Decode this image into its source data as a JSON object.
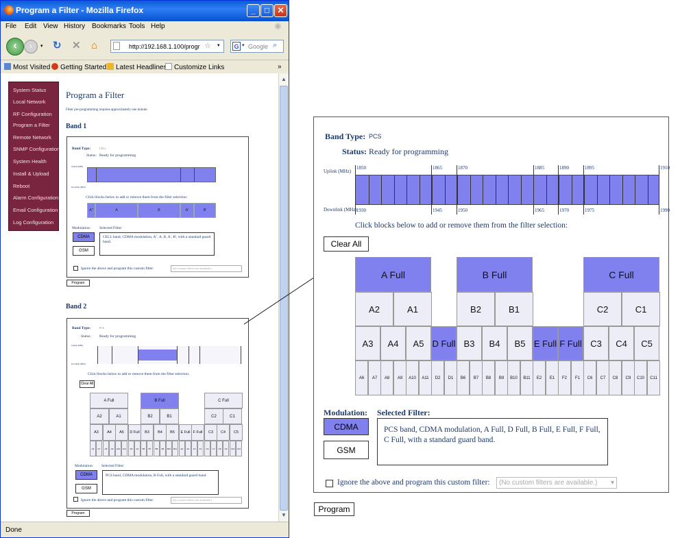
{
  "browser": {
    "title": "Program a Filter - Mozilla Firefox",
    "menu": [
      "File",
      "Edit",
      "View",
      "History",
      "Bookmarks",
      "Tools",
      "Help"
    ],
    "url": "http://192.168.1.100/progr",
    "search_placeholder": "Google",
    "bookmarks": [
      "Most Visited",
      "Getting Started",
      "Latest Headlines",
      "Customize Links"
    ],
    "status": "Done"
  },
  "sidebar": {
    "items": [
      "System Status",
      "Local Network",
      "RF Configuration",
      "Program a Filter",
      "Remote Network",
      "SNMP Configuration",
      "System Health",
      "Install & Upload",
      "Reboot",
      "Alarm Configuration",
      "Email Configuration",
      "Log Configuration"
    ]
  },
  "page": {
    "title": "Program a Filter",
    "note": "Filter pre-programming requires approximately one minute.",
    "band1_heading": "Band 1",
    "band2_heading": "Band 2",
    "program_label": "Program"
  },
  "band1": {
    "band_type_label": "Band Type:",
    "band_type_value": "CELL",
    "status_label": "Status:",
    "status_value": "Ready for programming",
    "uplink_label": "Uplink (MHz)",
    "downlink_label": "Downlink (MHz)",
    "uplink_ticks": [
      "824",
      "835",
      "845",
      "846.5",
      "849"
    ],
    "downlink_ticks": [
      "869",
      "880",
      "890",
      "891.5",
      "894"
    ],
    "instruction": "Click blocks below to add or remove them from the filter selection:",
    "blocks": [
      "A''",
      "A",
      "B",
      "A'",
      "B'"
    ],
    "modulation_label": "Modulation:",
    "selected_filter_label": "Selected Filter:",
    "selected_filter_text": "CELL band, CDMA modulation, A'', A, B, A', B', with a standard guard band.",
    "cdma": "CDMA",
    "gsm": "GSM",
    "ignore_text": "Ignore the above and program this custom filter:",
    "custom_filter": "(No custom filters are available.)"
  },
  "band2": {
    "band_type_label": "Band Type:",
    "band_type_value": "PCS",
    "status_label": "Status:",
    "status_value": "Ready for programming",
    "uplink_label": "Uplink (MHz)",
    "downlink_label": "Downlink (MHz)",
    "uplink_ticks": [
      "1850",
      "1865",
      "1870",
      "1885",
      "1890",
      "1895",
      "1910"
    ],
    "downlink_ticks": [
      "1930",
      "1945",
      "1950",
      "1965",
      "1970",
      "1975",
      "1990"
    ],
    "instruction": "Click blocks below to add or remove them from the filter selection:",
    "clear_all": "Clear All",
    "full_blocks": [
      "A Full",
      "B Full",
      "C Full"
    ],
    "row2": [
      "A2",
      "A1",
      "B2",
      "B1",
      "C2",
      "C1"
    ],
    "row3": [
      "A3",
      "A4",
      "A5",
      "D Full",
      "B3",
      "B4",
      "B5",
      "E Full",
      "F Full",
      "C3",
      "C4",
      "C5"
    ],
    "row4": [
      "A6",
      "A7",
      "A8",
      "A9",
      "A10",
      "A11",
      "D2",
      "D1",
      "B6",
      "B7",
      "B8",
      "B9",
      "B10",
      "B11",
      "E2",
      "E1",
      "F2",
      "F1",
      "C6",
      "C7",
      "C8",
      "C9",
      "C10",
      "C11"
    ],
    "modulation_label": "Modulation:",
    "selected_filter_label": "Selected Filter:",
    "selected_filter_text_small": "PCS band, CDMA modulation, B Full, with a standard guard band.",
    "cdma": "CDMA",
    "gsm": "GSM",
    "ignore_text": "Ignore the above and program this custom filter:",
    "custom_filter": "(No custom filters are available.)"
  },
  "zoom": {
    "band_type_label": "Band Type:",
    "band_type_value": "PCS",
    "status_label": "Status:",
    "status_value": "Ready for programming",
    "uplink_label": "Uplink (MHz)",
    "downlink_label": "Downlink (MHz)",
    "uplink_ticks": [
      "1850",
      "1865",
      "1870",
      "1885",
      "1890",
      "1895",
      "1910"
    ],
    "downlink_ticks": [
      "1930",
      "1945",
      "1950",
      "1965",
      "1970",
      "1975",
      "1990"
    ],
    "instruction": "Click blocks below to add or remove them from the filter selection:",
    "clear_all": "Clear All",
    "modulation_label": "Modulation:",
    "selected_filter_label": "Selected Filter:",
    "selected_filter_text": "PCS band, CDMA modulation, A Full, D Full, B Full, E Full, F Full, C Full, with a standard guard band.",
    "cdma": "CDMA",
    "gsm": "GSM",
    "ignore_text": "Ignore the above and program this custom filter:",
    "custom_filter": "(No custom filters are available.)",
    "program_label": "Program"
  },
  "colors": {
    "selected": "#8080ee",
    "unselected": "#ededf8",
    "nav": "#7a2540",
    "heading": "#1c3a6c"
  }
}
